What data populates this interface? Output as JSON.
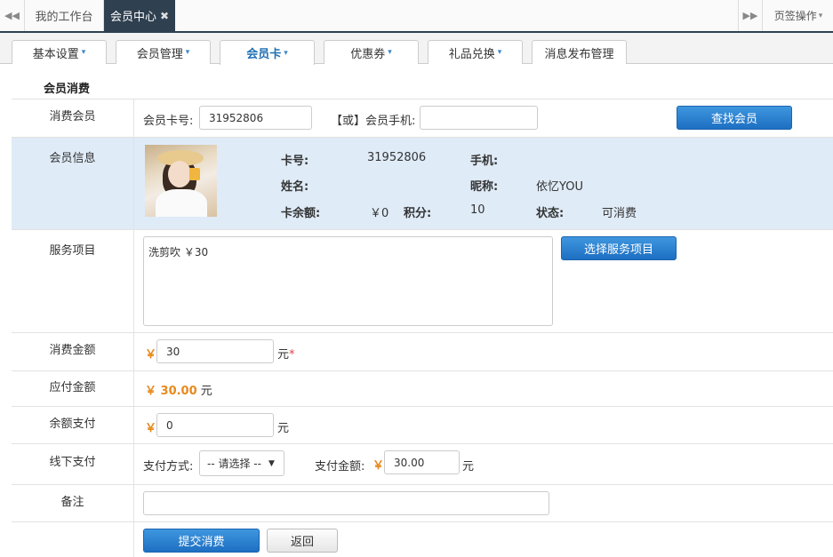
{
  "tabs": {
    "home": "我的工作台",
    "active": "会员中心",
    "page_ops": "页签操作"
  },
  "subnav": [
    {
      "label": "基本设置"
    },
    {
      "label": "会员管理"
    },
    {
      "label": "会员卡"
    },
    {
      "label": "优惠券"
    },
    {
      "label": "礼品兑换"
    },
    {
      "label": "消息发布管理"
    }
  ],
  "form": {
    "section_title": "会员消费",
    "consumer": {
      "label": "消费会员",
      "card_no_label": "会员卡号:",
      "card_no_value": "31952806",
      "or_label": "【或】会员手机:",
      "phone_value": "",
      "search_button": "查找会员"
    },
    "member_info": {
      "label": "会员信息",
      "card_no_label": "卡号:",
      "card_no": "31952806",
      "phone_label": "手机:",
      "phone": "",
      "name_label": "姓名:",
      "name": "",
      "nickname_label": "昵称:",
      "nickname": "依忆YOU",
      "balance_label": "卡余额:",
      "balance": "￥0",
      "points_label": "积分:",
      "points": "10",
      "status_label": "状态:",
      "status": "可消费"
    },
    "service": {
      "label": "服务项目",
      "value": "洗剪吹 ￥30",
      "select_button": "选择服务项目"
    },
    "amount": {
      "label": "消费金额",
      "currency": "￥",
      "value": "30",
      "unit": "元",
      "required_mark": "*"
    },
    "payable": {
      "label": "应付金额",
      "value": "￥ 30.00",
      "unit": "元"
    },
    "balance_pay": {
      "label": "余额支付",
      "currency": "￥",
      "value": "0",
      "unit": "元"
    },
    "offline": {
      "label": "线下支付",
      "method_label": "支付方式:",
      "method_value": "-- 请选择 --",
      "pay_amount_label": "支付金额:",
      "currency": "￥",
      "pay_amount": "30.00",
      "unit": "元"
    },
    "remark": {
      "label": "备注",
      "value": ""
    },
    "actions": {
      "submit": "提交消费",
      "back": "返回"
    }
  },
  "colors": {
    "dark_bar": "#2f4050",
    "info_bg": "#dfebf7",
    "accent_blue": "#1d6fc2",
    "currency_orange": "#e8891c"
  }
}
